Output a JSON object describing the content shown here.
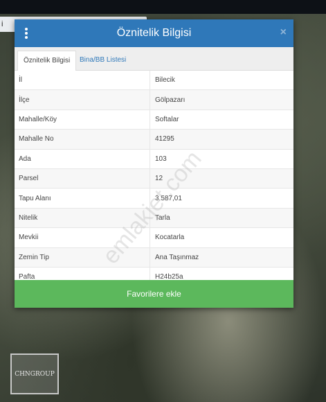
{
  "corner_chip": {
    "text": "i"
  },
  "dialog": {
    "title": "Öznitelik Bilgisi",
    "close_symbol": "×",
    "tabs": [
      {
        "label": "Öznitelik Bilgisi",
        "active": true
      },
      {
        "label": "Bina/BB Listesi",
        "active": false
      }
    ],
    "rows": [
      {
        "key": "İl",
        "value": "Bilecik"
      },
      {
        "key": "İlçe",
        "value": "Gölpazarı"
      },
      {
        "key": "Mahalle/Köy",
        "value": "Softalar"
      },
      {
        "key": "Mahalle No",
        "value": "41295"
      },
      {
        "key": "Ada",
        "value": "103"
      },
      {
        "key": "Parsel",
        "value": "12"
      },
      {
        "key": "Tapu Alanı",
        "value": "3.587,01"
      },
      {
        "key": "Nitelik",
        "value": "Tarla"
      },
      {
        "key": "Mevkii",
        "value": "Kocatarla"
      },
      {
        "key": "Zemin Tip",
        "value": "Ana Taşınmaz"
      },
      {
        "key": "Pafta",
        "value": "H24b25a"
      }
    ],
    "favorite_button": "Favorilere ekle"
  },
  "watermark": "emlakjet.com",
  "logo_text": "CHNGROUP",
  "colors": {
    "header": "#2f78b9",
    "button": "#5cb85c"
  }
}
